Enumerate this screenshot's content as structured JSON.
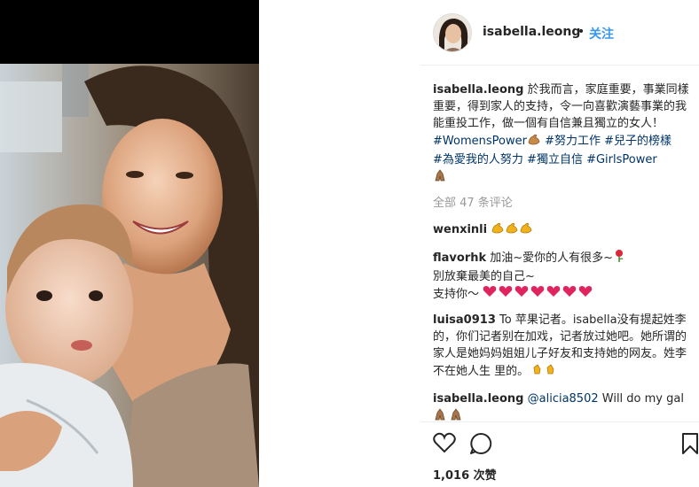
{
  "post": {
    "username": "isabella.leong",
    "follow_label": "关注",
    "header_dot": "•",
    "caption": {
      "username": "isabella.leong",
      "text": "於我而言，家庭重要，事業同樣重要，得到家人的支持，令一向喜歡演藝事業的我能重投工作，做一個有自信兼且獨立的女人！",
      "hashtags_line1": [
        "#WomensPower",
        "#努力工作",
        "#兒子的榜樣"
      ],
      "hashtags_line2": [
        "#為愛我的人努力",
        "#獨立自信",
        "#GirlsPower"
      ]
    },
    "view_all_comments": "全部 47 条评论",
    "comments": [
      {
        "username": "wenxinli",
        "text": ""
      },
      {
        "username": "flavorhk",
        "text_lines": [
          "加油~愛你的人有很多~",
          "別放棄最美的自己~",
          "支持你～"
        ]
      },
      {
        "username": "luisa0913",
        "text": "To 苹果记者。isabella没有提起姓李的，你们记者别在加戏，记者放过她吧。她所谓的家人是她妈妈姐姐儿子好友和支持她的网友。姓李不在她人生 里的。"
      },
      {
        "username": "isabella.leong",
        "mention": "@alicia8502",
        "text": "Will do my gal"
      }
    ],
    "likes_count": "1,016",
    "likes_label": "次赞"
  },
  "icons": {
    "heart": "heart-icon",
    "comment": "comment-icon",
    "bookmark": "bookmark-icon",
    "emoji_muscle": "flexed-biceps-icon",
    "emoji_pray": "folded-hands-icon",
    "emoji_clap": "clapping-hands-icon",
    "emoji_heart": "red-heart-icon",
    "emoji_rose": "rose-icon"
  },
  "colors": {
    "link_blue": "#3897f0",
    "hashtag_blue": "#003569",
    "muted": "#999999",
    "text": "#262626",
    "emoji_heart": "#e0245e"
  }
}
